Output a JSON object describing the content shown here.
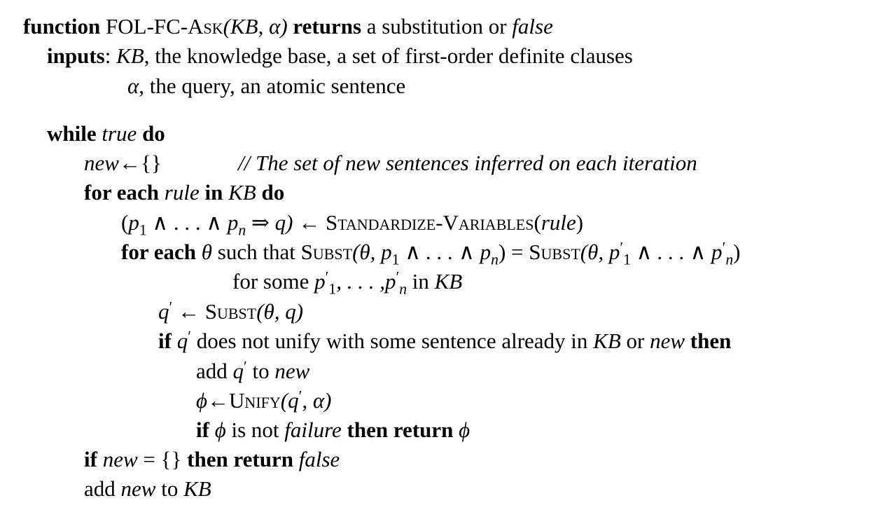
{
  "header": {
    "kw_function": "function",
    "fn_name": "FOL-FC-Ask",
    "params": "(KB, α)",
    "kw_returns": "returns",
    "return_desc": "a substitution or",
    "return_false": "false"
  },
  "inputs": {
    "label": "inputs",
    "kb_name": "KB",
    "kb_desc": ", the knowledge base, a set of first-order definite clauses",
    "alpha_name": "α",
    "alpha_desc": ", the query, an atomic sentence"
  },
  "body": {
    "while_kw": "while",
    "while_cond": "true",
    "while_do": "do",
    "new_var": "new",
    "new_assign": "←{}",
    "comment": "// The set of new sentences inferred on each iteration",
    "for_each": "for each",
    "rule_var": "rule",
    "in_kw": "in",
    "kb": "KB",
    "do_kw": "do",
    "std_lhs_open": "(",
    "std_p": "p",
    "std_and_dots": " ∧ . . . ∧ ",
    "std_implies_q": " ⇒ q)",
    "std_arrow": " ← ",
    "std_fn": "Standardize-Variables",
    "std_arg_open": "(",
    "std_arg": "rule",
    "std_arg_close": ")",
    "theta_for": "for each",
    "theta": "θ",
    "such_that": " such that ",
    "subst_fn": "Subst",
    "theta_args1": "(θ, p",
    "dots_and": " ∧ . . . ∧ p",
    "eq": ") = ",
    "theta_args2": "(θ, p",
    "close_paren": ")",
    "for_some": "for some ",
    "p_prime": "p",
    "prime": "′",
    "dots_comma": ", . . . ,",
    "in_word": " in ",
    "q_prime_lhs": "q",
    "q_arrow": " ← ",
    "subst_q_args": "(θ, q)",
    "if_kw": "if",
    "unify_cond": " does not unify with some sentence already in ",
    "or_word": " or ",
    "then_kw": "then",
    "add_word": "add ",
    "to_word": " to ",
    "phi": "ϕ",
    "phi_arrow": "←",
    "unify_fn": "Unify",
    "unify_args_open": "(q",
    "unify_args_close": ", α)",
    "is_not": " is not ",
    "failure": "failure",
    "then_return": "then return",
    "if_new_eq": " = {}",
    "false_word": "false",
    "add_new": "add ",
    "to_kb": " to "
  },
  "subscripts": {
    "one": "1",
    "n": "n"
  }
}
